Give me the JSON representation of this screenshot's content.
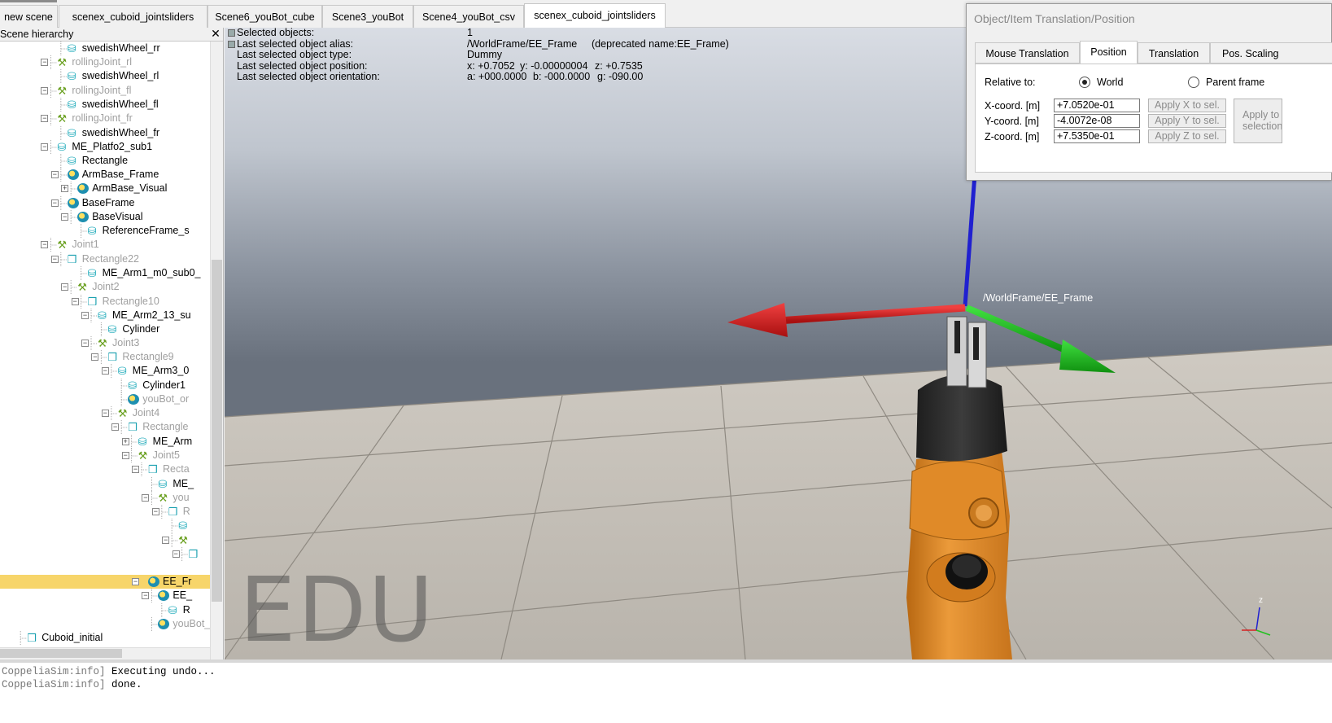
{
  "tabs": [
    {
      "label": "new scene"
    },
    {
      "label": "scenex_cuboid_jointsliders"
    },
    {
      "label": "Scene6_youBot_cube"
    },
    {
      "label": "Scene3_youBot"
    },
    {
      "label": "Scene4_youBot_csv"
    },
    {
      "label": "scenex_cuboid_jointsliders"
    }
  ],
  "hierarchy": {
    "title": "Scene hierarchy",
    "close_glyph": "✕",
    "rows": [
      {
        "label": "swedishWheel_rr",
        "icon": "shape-icon",
        "dim": false
      },
      {
        "label": "rollingJoint_rl",
        "icon": "joint-icon",
        "dim": true
      },
      {
        "label": "swedishWheel_rl",
        "icon": "shape-icon",
        "dim": false
      },
      {
        "label": "rollingJoint_fl",
        "icon": "joint-icon",
        "dim": true
      },
      {
        "label": "swedishWheel_fl",
        "icon": "shape-icon",
        "dim": false
      },
      {
        "label": "rollingJoint_fr",
        "icon": "joint-icon",
        "dim": true
      },
      {
        "label": "swedishWheel_fr",
        "icon": "shape-icon",
        "dim": false
      },
      {
        "label": "ME_Platfo2_sub1",
        "icon": "shape-icon",
        "dim": false
      },
      {
        "label": "Rectangle",
        "icon": "shape-icon",
        "dim": false
      },
      {
        "label": "ArmBase_Frame",
        "icon": "dummy-icon",
        "dim": false
      },
      {
        "label": "ArmBase_Visual",
        "icon": "dummy-icon",
        "dim": false
      },
      {
        "label": "BaseFrame",
        "icon": "dummy-icon",
        "dim": false
      },
      {
        "label": "BaseVisual",
        "icon": "dummy-icon",
        "dim": false
      },
      {
        "label": "ReferenceFrame_s",
        "icon": "shape-icon",
        "dim": false
      },
      {
        "label": "Joint1",
        "icon": "joint-icon",
        "dim": true
      },
      {
        "label": "Rectangle22",
        "icon": "box-icon",
        "dim": true
      },
      {
        "label": "ME_Arm1_m0_sub0_",
        "icon": "shape-icon",
        "dim": false
      },
      {
        "label": "Joint2",
        "icon": "joint-icon",
        "dim": true
      },
      {
        "label": "Rectangle10",
        "icon": "box-icon",
        "dim": true
      },
      {
        "label": "ME_Arm2_13_su",
        "icon": "shape-icon",
        "dim": false
      },
      {
        "label": "Cylinder",
        "icon": "shape-icon",
        "dim": false
      },
      {
        "label": "Joint3",
        "icon": "joint-icon",
        "dim": true
      },
      {
        "label": "Rectangle9",
        "icon": "box-icon",
        "dim": true
      },
      {
        "label": "ME_Arm3_0",
        "icon": "shape-icon",
        "dim": false
      },
      {
        "label": "Cylinder1",
        "icon": "shape-icon",
        "dim": false
      },
      {
        "label": "youBot_or",
        "icon": "dummy-icon",
        "dim": true
      },
      {
        "label": "Joint4",
        "icon": "joint-icon",
        "dim": true
      },
      {
        "label": "Rectangle",
        "icon": "box-icon",
        "dim": true
      },
      {
        "label": "ME_Arm",
        "icon": "shape-icon",
        "dim": false
      },
      {
        "label": "Joint5",
        "icon": "joint-icon",
        "dim": true
      },
      {
        "label": "Recta",
        "icon": "box-icon",
        "dim": true
      },
      {
        "label": "ME_",
        "icon": "shape-icon",
        "dim": false
      },
      {
        "label": "you",
        "icon": "joint-icon",
        "dim": true
      },
      {
        "label": "R",
        "icon": "box-icon",
        "dim": true
      },
      {
        "label": "",
        "icon": "shape-icon",
        "dim": false
      },
      {
        "label": "",
        "icon": "joint-icon",
        "dim": true
      },
      {
        "label": "",
        "icon": "box-icon",
        "dim": true
      },
      {
        "label": "",
        "icon": "",
        "dim": false
      },
      {
        "label": "EE_Fr",
        "icon": "dummy-icon",
        "dim": false,
        "selected": true
      },
      {
        "label": "EE_",
        "icon": "dummy-icon",
        "dim": false
      },
      {
        "label": "R",
        "icon": "shape-icon",
        "dim": false
      },
      {
        "label": "youBot_",
        "icon": "dummy-icon",
        "dim": true
      },
      {
        "label": "Cuboid_initial",
        "icon": "box-icon",
        "dim": false
      }
    ]
  },
  "viewport": {
    "info": {
      "labels": [
        "Selected objects:",
        "Last selected object alias:",
        "Last selected object type:",
        "Last selected object position:",
        "Last selected object orientation:"
      ],
      "selected_count": "1",
      "alias": "/WorldFrame/EE_Frame",
      "deprecated": "(deprecated name:EE_Frame)",
      "type": "Dummy",
      "pos_x": "x: +0.7052",
      "pos_y": "y: -0.00000004",
      "pos_z": "z: +0.7535",
      "ori_a": "a: +000.0000",
      "ori_b": "b: -000.0000",
      "ori_g": "g: -090.00"
    },
    "frame_label": "/WorldFrame/EE_Frame",
    "watermark": "EDU",
    "axis_label": "z",
    "colors": {
      "x_axis": "#d62020",
      "y_axis": "#22c020",
      "z_axis": "#2020d0",
      "robot_orange": "#e8902a"
    }
  },
  "dialog": {
    "title": "Object/Item Translation/Position",
    "tabs": [
      "Mouse Translation",
      "Position",
      "Translation",
      "Pos. Scaling"
    ],
    "active_tab": "Position",
    "relative_to_label": "Relative to:",
    "radio_world": "World",
    "radio_parent": "Parent frame",
    "x_label": "X-coord. [m]",
    "y_label": "Y-coord. [m]",
    "z_label": "Z-coord. [m]",
    "x_value": "+7.0520e-01",
    "y_value": "-4.0072e-08",
    "z_value": "+7.5350e-01",
    "apply_x": "Apply X to sel.",
    "apply_y": "Apply Y to sel.",
    "apply_z": "Apply Z to sel.",
    "apply_all_line1": "Apply to",
    "apply_all_line2": "selection"
  },
  "console": {
    "lines": [
      {
        "prefix": "CoppeliaSim:info]",
        "text": " Executing undo..."
      },
      {
        "prefix": "CoppeliaSim:info]",
        "text": " done."
      }
    ]
  }
}
